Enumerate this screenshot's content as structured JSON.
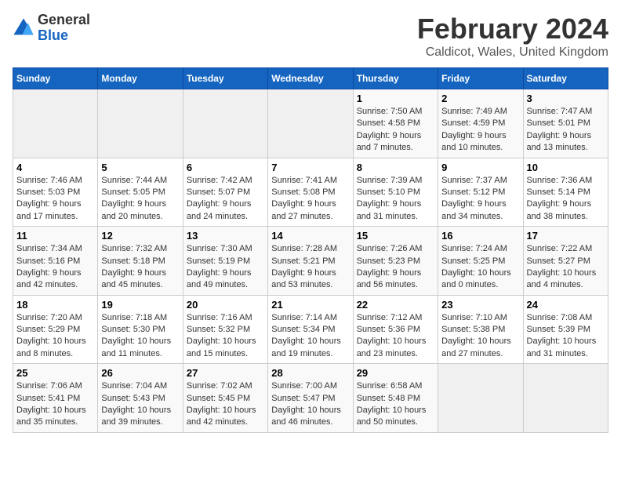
{
  "logo": {
    "line1": "General",
    "line2": "Blue"
  },
  "title": "February 2024",
  "subtitle": "Caldicot, Wales, United Kingdom",
  "days_of_week": [
    "Sunday",
    "Monday",
    "Tuesday",
    "Wednesday",
    "Thursday",
    "Friday",
    "Saturday"
  ],
  "weeks": [
    [
      {
        "day": "",
        "info": ""
      },
      {
        "day": "",
        "info": ""
      },
      {
        "day": "",
        "info": ""
      },
      {
        "day": "",
        "info": ""
      },
      {
        "day": "1",
        "info": "Sunrise: 7:50 AM\nSunset: 4:58 PM\nDaylight: 9 hours and 7 minutes."
      },
      {
        "day": "2",
        "info": "Sunrise: 7:49 AM\nSunset: 4:59 PM\nDaylight: 9 hours and 10 minutes."
      },
      {
        "day": "3",
        "info": "Sunrise: 7:47 AM\nSunset: 5:01 PM\nDaylight: 9 hours and 13 minutes."
      }
    ],
    [
      {
        "day": "4",
        "info": "Sunrise: 7:46 AM\nSunset: 5:03 PM\nDaylight: 9 hours and 17 minutes."
      },
      {
        "day": "5",
        "info": "Sunrise: 7:44 AM\nSunset: 5:05 PM\nDaylight: 9 hours and 20 minutes."
      },
      {
        "day": "6",
        "info": "Sunrise: 7:42 AM\nSunset: 5:07 PM\nDaylight: 9 hours and 24 minutes."
      },
      {
        "day": "7",
        "info": "Sunrise: 7:41 AM\nSunset: 5:08 PM\nDaylight: 9 hours and 27 minutes."
      },
      {
        "day": "8",
        "info": "Sunrise: 7:39 AM\nSunset: 5:10 PM\nDaylight: 9 hours and 31 minutes."
      },
      {
        "day": "9",
        "info": "Sunrise: 7:37 AM\nSunset: 5:12 PM\nDaylight: 9 hours and 34 minutes."
      },
      {
        "day": "10",
        "info": "Sunrise: 7:36 AM\nSunset: 5:14 PM\nDaylight: 9 hours and 38 minutes."
      }
    ],
    [
      {
        "day": "11",
        "info": "Sunrise: 7:34 AM\nSunset: 5:16 PM\nDaylight: 9 hours and 42 minutes."
      },
      {
        "day": "12",
        "info": "Sunrise: 7:32 AM\nSunset: 5:18 PM\nDaylight: 9 hours and 45 minutes."
      },
      {
        "day": "13",
        "info": "Sunrise: 7:30 AM\nSunset: 5:19 PM\nDaylight: 9 hours and 49 minutes."
      },
      {
        "day": "14",
        "info": "Sunrise: 7:28 AM\nSunset: 5:21 PM\nDaylight: 9 hours and 53 minutes."
      },
      {
        "day": "15",
        "info": "Sunrise: 7:26 AM\nSunset: 5:23 PM\nDaylight: 9 hours and 56 minutes."
      },
      {
        "day": "16",
        "info": "Sunrise: 7:24 AM\nSunset: 5:25 PM\nDaylight: 10 hours and 0 minutes."
      },
      {
        "day": "17",
        "info": "Sunrise: 7:22 AM\nSunset: 5:27 PM\nDaylight: 10 hours and 4 minutes."
      }
    ],
    [
      {
        "day": "18",
        "info": "Sunrise: 7:20 AM\nSunset: 5:29 PM\nDaylight: 10 hours and 8 minutes."
      },
      {
        "day": "19",
        "info": "Sunrise: 7:18 AM\nSunset: 5:30 PM\nDaylight: 10 hours and 11 minutes."
      },
      {
        "day": "20",
        "info": "Sunrise: 7:16 AM\nSunset: 5:32 PM\nDaylight: 10 hours and 15 minutes."
      },
      {
        "day": "21",
        "info": "Sunrise: 7:14 AM\nSunset: 5:34 PM\nDaylight: 10 hours and 19 minutes."
      },
      {
        "day": "22",
        "info": "Sunrise: 7:12 AM\nSunset: 5:36 PM\nDaylight: 10 hours and 23 minutes."
      },
      {
        "day": "23",
        "info": "Sunrise: 7:10 AM\nSunset: 5:38 PM\nDaylight: 10 hours and 27 minutes."
      },
      {
        "day": "24",
        "info": "Sunrise: 7:08 AM\nSunset: 5:39 PM\nDaylight: 10 hours and 31 minutes."
      }
    ],
    [
      {
        "day": "25",
        "info": "Sunrise: 7:06 AM\nSunset: 5:41 PM\nDaylight: 10 hours and 35 minutes."
      },
      {
        "day": "26",
        "info": "Sunrise: 7:04 AM\nSunset: 5:43 PM\nDaylight: 10 hours and 39 minutes."
      },
      {
        "day": "27",
        "info": "Sunrise: 7:02 AM\nSunset: 5:45 PM\nDaylight: 10 hours and 42 minutes."
      },
      {
        "day": "28",
        "info": "Sunrise: 7:00 AM\nSunset: 5:47 PM\nDaylight: 10 hours and 46 minutes."
      },
      {
        "day": "29",
        "info": "Sunrise: 6:58 AM\nSunset: 5:48 PM\nDaylight: 10 hours and 50 minutes."
      },
      {
        "day": "",
        "info": ""
      },
      {
        "day": "",
        "info": ""
      }
    ]
  ]
}
